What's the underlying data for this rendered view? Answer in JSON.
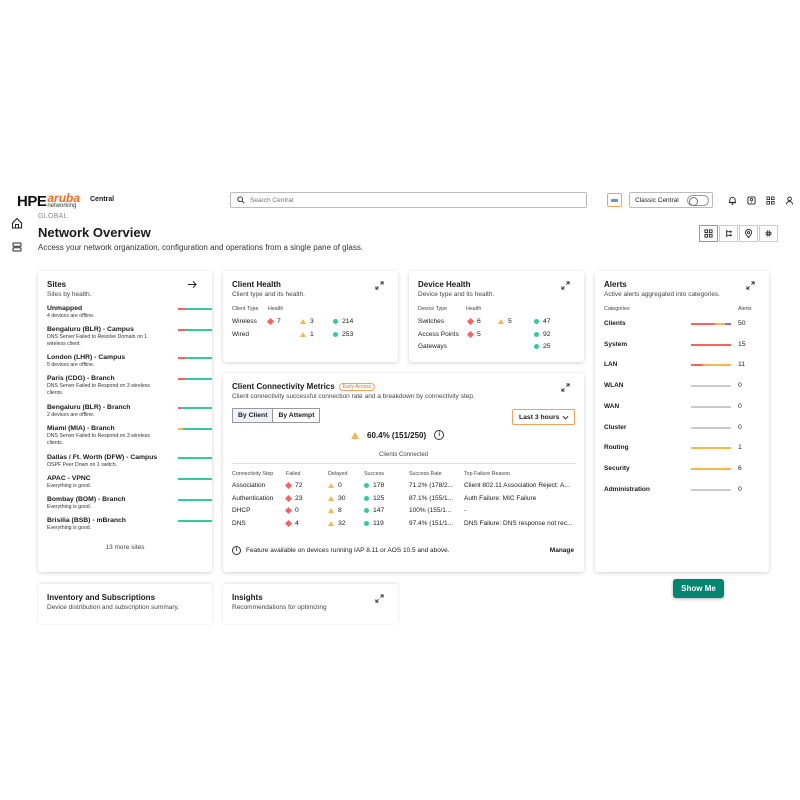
{
  "brand": {
    "hpe": "HPE",
    "aruba": "aruba",
    "networking": "networking",
    "app": "Central"
  },
  "search": {
    "placeholder": "Search Central"
  },
  "classic": {
    "label": "Classic Central"
  },
  "header": {
    "crumb": "GLOBAL",
    "title": "Network Overview",
    "subtitle": "Access your network organization, configuration and operations from a single pane of glass."
  },
  "sites": {
    "title": "Sites",
    "subtitle": "Sites by health.",
    "items": [
      {
        "name": "Unmapped",
        "desc": "4 devices are offline.",
        "health": "critical"
      },
      {
        "name": "Bengaluru (BLR) - Campus",
        "desc": "DNS Server Failed to Resolve Domain on 1 wireless client.",
        "health": "critical"
      },
      {
        "name": "London (LHR) - Campus",
        "desc": "5 devices are offline.",
        "health": "critical"
      },
      {
        "name": "Paris (CDG) - Branch",
        "desc": "DNS Server Failed to Respond on 3 wireless clients.",
        "health": "critical"
      },
      {
        "name": "Bengaluru (BLR) - Branch",
        "desc": "2 devices are offline.",
        "health": "critical"
      },
      {
        "name": "Miami (MIA) - Branch",
        "desc": "DNS Server Failed to Respond on 3 wireless clients.",
        "health": "warning"
      },
      {
        "name": "Dallas / Ft. Worth (DFW) - Campus",
        "desc": "OSPF Peer Down on 1 switch.",
        "health": "good"
      },
      {
        "name": "APAC - VPNC",
        "desc": "Everything is good.",
        "health": "good"
      },
      {
        "name": "Bombay (BOM) - Branch",
        "desc": "Everything is good.",
        "health": "good"
      },
      {
        "name": "Brisilia (BSB) - mBranch",
        "desc": "Everything is good.",
        "health": "good"
      }
    ],
    "more": "13 more sites"
  },
  "client_health": {
    "title": "Client Health",
    "subtitle": "Client type and its health.",
    "col_type": "Client Type",
    "col_health": "Health",
    "rows": [
      {
        "type": "Wireless",
        "poor": "7",
        "fair": "3",
        "good": "214"
      },
      {
        "type": "Wired",
        "poor": "",
        "fair": "1",
        "good": "253"
      }
    ]
  },
  "device_health": {
    "title": "Device Health",
    "subtitle": "Device type and its health.",
    "col_type": "Device Type",
    "col_health": "Health",
    "rows": [
      {
        "type": "Switches",
        "poor": "6",
        "fair": "5",
        "good": "47"
      },
      {
        "type": "Access Points",
        "poor": "5",
        "fair": "",
        "good": "92"
      },
      {
        "type": "Gateways",
        "poor": "",
        "fair": "",
        "good": "25"
      }
    ]
  },
  "alerts": {
    "title": "Alerts",
    "subtitle": "Active alerts aggregated into categories.",
    "col_cat": "Categories",
    "col_alerts": "Alerts",
    "rows": [
      {
        "name": "Clients",
        "value": "50",
        "mix": [
          0.6,
          0.25,
          0.15
        ]
      },
      {
        "name": "System",
        "value": "15",
        "mix": [
          1,
          0,
          0
        ]
      },
      {
        "name": "LAN",
        "value": "11",
        "mix": [
          0.3,
          0.7,
          0
        ]
      },
      {
        "name": "WLAN",
        "value": "0",
        "mix": [
          0,
          0,
          0
        ]
      },
      {
        "name": "WAN",
        "value": "0",
        "mix": [
          0,
          0,
          0
        ]
      },
      {
        "name": "Cluster",
        "value": "0",
        "mix": [
          0,
          0,
          0
        ]
      },
      {
        "name": "Routing",
        "value": "1",
        "mix": [
          0,
          1,
          0
        ]
      },
      {
        "name": "Security",
        "value": "6",
        "mix": [
          0,
          1,
          0
        ]
      },
      {
        "name": "Administration",
        "value": "0",
        "mix": [
          0,
          0,
          0
        ]
      }
    ]
  },
  "connectivity": {
    "title": "Client Connectivity Metrics",
    "badge": "Early Access",
    "subtitle": "Client connectivity successful connection rate and a breakdown by connectivity step.",
    "tab_client": "By Client",
    "tab_attempt": "By Attempt",
    "range": "Last 3 hours",
    "stat": "60.4% (151/250)",
    "stat_label": "Clients Connected",
    "headers": {
      "step": "Connectivity Step",
      "failed": "Failed",
      "delayed": "Delayed",
      "success": "Success",
      "rate": "Success Rate",
      "reason": "Top Failure Reason"
    },
    "rows": [
      {
        "step": "Association",
        "failed": "72",
        "delayed": "0",
        "success": "178",
        "rate": "71.2% (178/2...",
        "reason": "Client 802.11 Association Reject: A..."
      },
      {
        "step": "Authentication",
        "failed": "23",
        "delayed": "30",
        "success": "125",
        "rate": "87.1% (155/1...",
        "reason": "Auth Failure: MIC Failure"
      },
      {
        "step": "DHCP",
        "failed": "0",
        "delayed": "8",
        "success": "147",
        "rate": "100% (155/1...",
        "reason": "-"
      },
      {
        "step": "DNS",
        "failed": "4",
        "delayed": "32",
        "success": "119",
        "rate": "97.4% (151/1...",
        "reason": "DNS Failure: DNS response not rec..."
      }
    ],
    "note": "Feature available on devices running IAP 8.11 or AOS 10.5 and above.",
    "manage": "Manage"
  },
  "inventory": {
    "title": "Inventory and Subscriptions",
    "subtitle": "Device distribution and subscription summary."
  },
  "insights": {
    "title": "Insights",
    "subtitle": "Recommendations for optimizing"
  },
  "show_me": "Show Me",
  "colors": {
    "critical": "#fc6161",
    "warning": "#f6b84b",
    "good": "#33cc99",
    "accent": "#f3a25b",
    "brand": "#01856f"
  }
}
